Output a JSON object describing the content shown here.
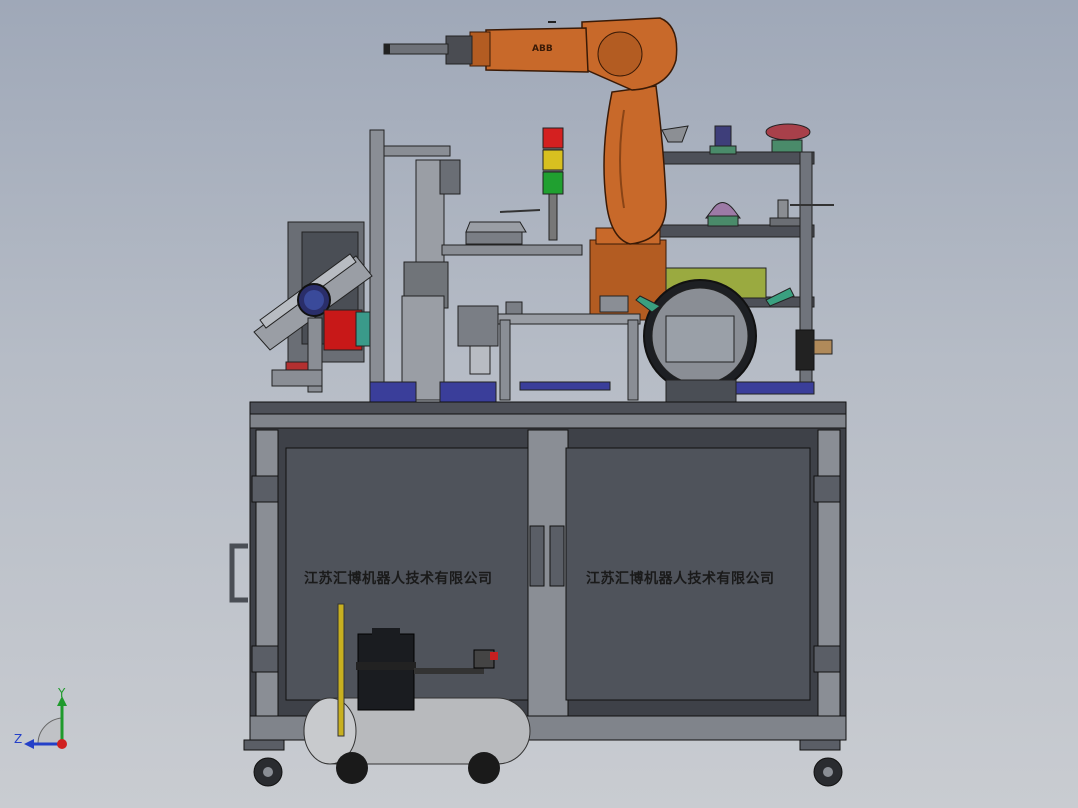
{
  "cabinet": {
    "left_panel_text": "江苏汇博机器人技术有限公司",
    "right_panel_text": "江苏汇博机器人技术有限公司"
  },
  "robot": {
    "brand_label": "ABB"
  },
  "triad": {
    "y_label": "Y",
    "z_label": "Z"
  },
  "colors": {
    "background_top": "#9fa8b8",
    "robot_orange": "#c8692a",
    "frame_gray": "#5a5e66",
    "panel_gray": "#4f535b",
    "signal_red": "#d42020",
    "signal_yellow": "#d8c020",
    "signal_green": "#20a030",
    "rotary_table_red": "#c81818",
    "tank_gray": "#b8babd",
    "axis_y": "#1f9a2c",
    "axis_z": "#2440c8",
    "axis_x": "#d02020"
  }
}
